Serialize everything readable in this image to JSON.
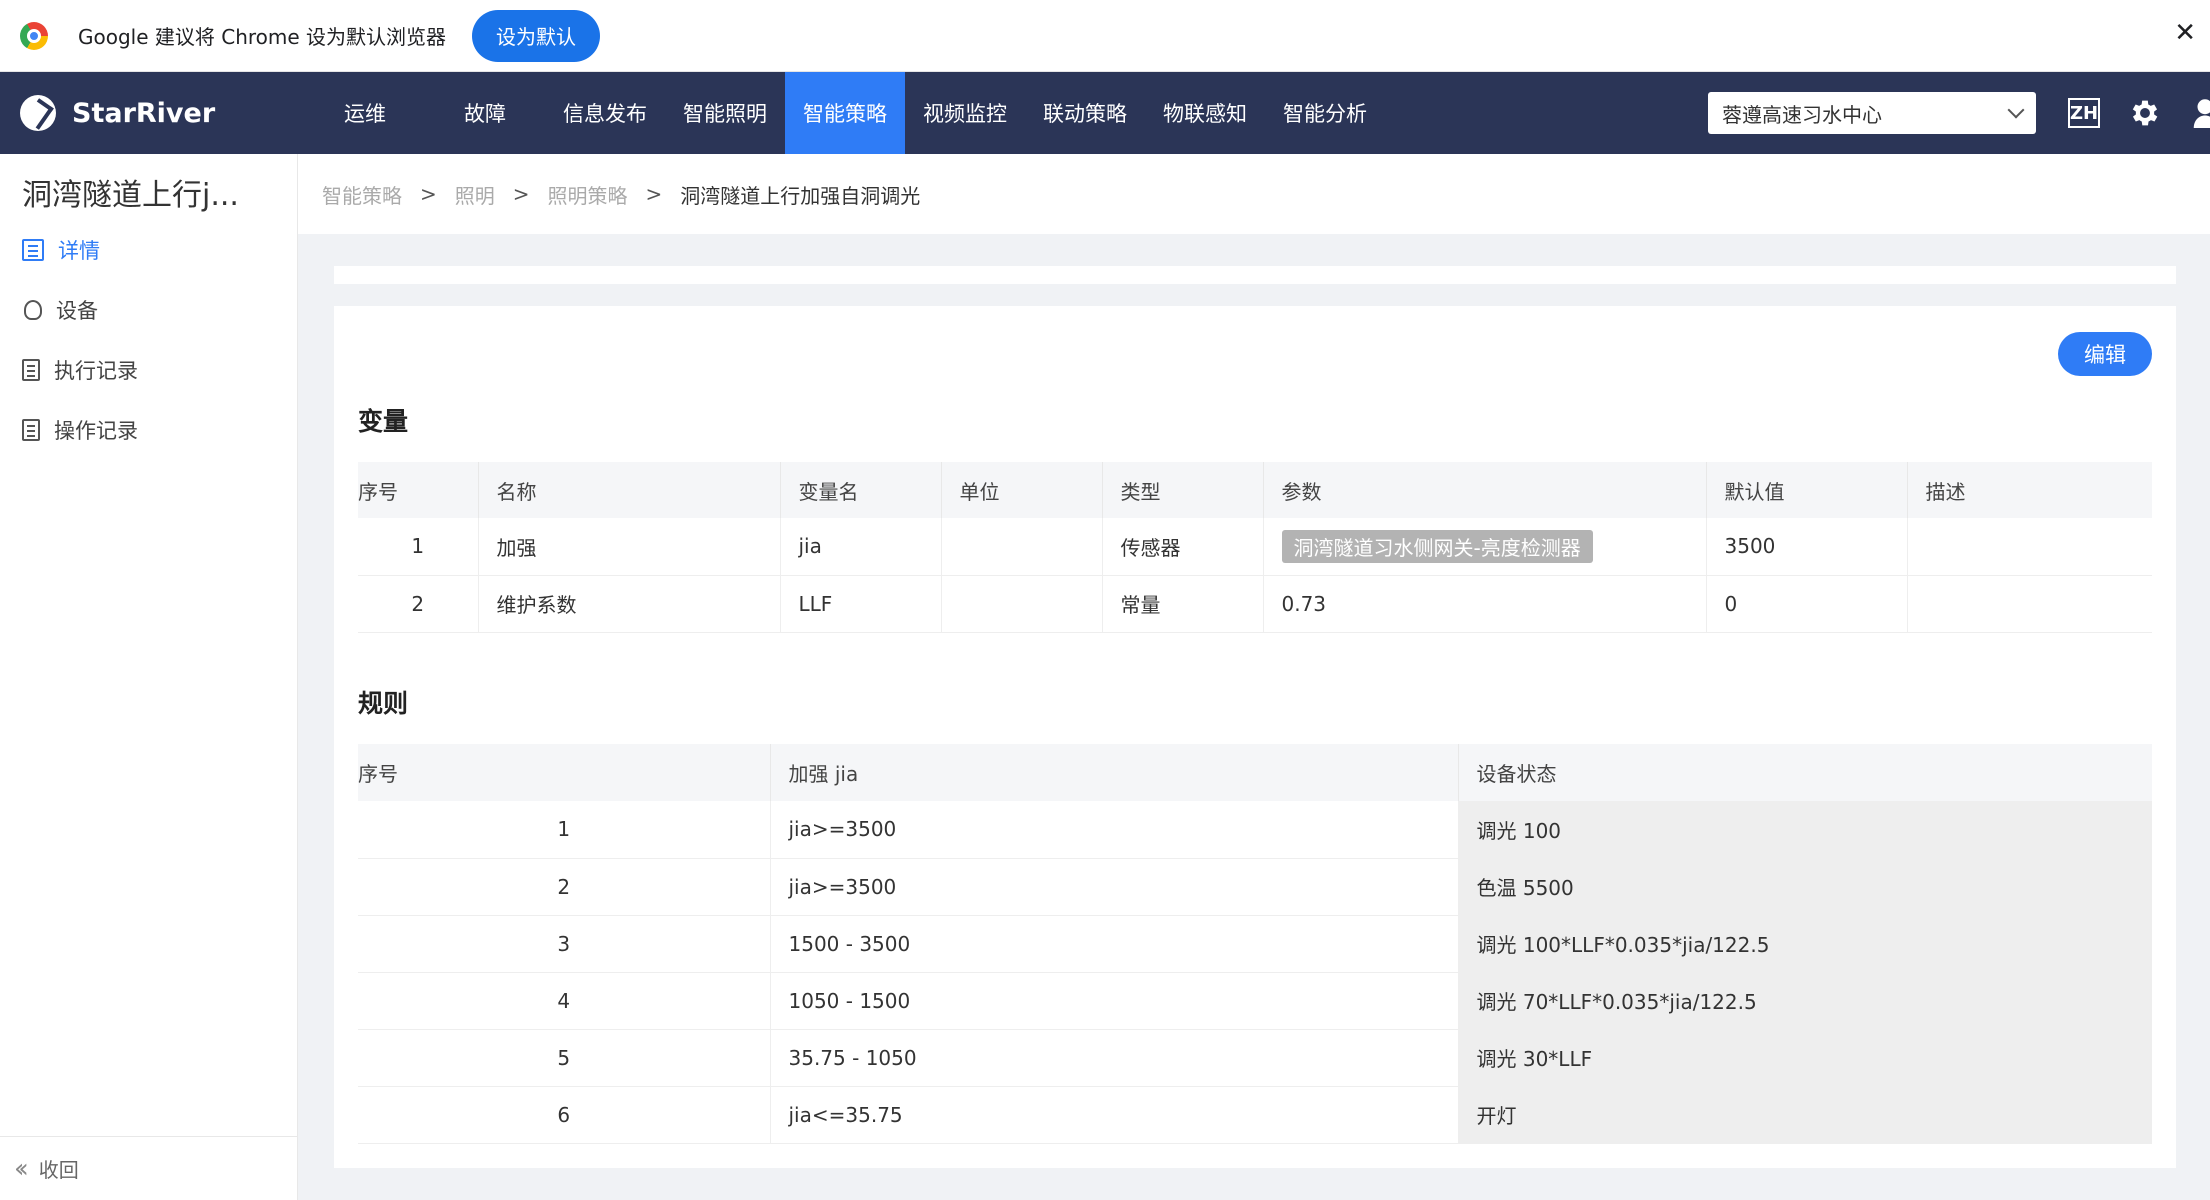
{
  "infobar": {
    "message": "Google 建议将 Chrome 设为默认浏览器",
    "button": "设为默认",
    "close": "✕"
  },
  "nav": {
    "brand": "StarRiver",
    "items": [
      {
        "label": "运维"
      },
      {
        "label": "故障"
      },
      {
        "label": "信息发布"
      },
      {
        "label": "智能照明"
      },
      {
        "label": "智能策略",
        "active": true
      },
      {
        "label": "视频监控"
      },
      {
        "label": "联动策略"
      },
      {
        "label": "物联感知"
      },
      {
        "label": "智能分析"
      }
    ],
    "org": "蓉遵高速习水中心",
    "lang": "ZH"
  },
  "sidebar": {
    "title": "洞湾隧道上行j...",
    "items": [
      {
        "label": "详情",
        "icon": "list-icon",
        "active": true
      },
      {
        "label": "设备",
        "icon": "bulb-icon"
      },
      {
        "label": "执行记录",
        "icon": "record-icon"
      },
      {
        "label": "操作记录",
        "icon": "log-icon"
      }
    ],
    "collapse": "收回"
  },
  "breadcrumb": {
    "items": [
      "智能策略",
      "照明",
      "照明策略"
    ],
    "current": "洞湾隧道上行加强自洞调光"
  },
  "main": {
    "edit_button": "编辑",
    "variables": {
      "title": "变量",
      "headers": [
        "序号",
        "名称",
        "变量名",
        "单位",
        "类型",
        "参数",
        "默认值",
        "描述"
      ],
      "rows": [
        {
          "no": "1",
          "name": "加强",
          "var": "jia",
          "unit": "",
          "type": "传感器",
          "param": "洞湾隧道习水侧网关-亮度检测器",
          "param_tag": true,
          "default": "3500",
          "desc": ""
        },
        {
          "no": "2",
          "name": "维护系数",
          "var": "LLF",
          "unit": "",
          "type": "常量",
          "param": "0.73",
          "param_tag": false,
          "default": "0",
          "desc": ""
        }
      ]
    },
    "rules": {
      "title": "规则",
      "headers": [
        "序号",
        "加强 jia",
        "设备状态"
      ],
      "rows": [
        {
          "no": "1",
          "cond": "jia>=3500",
          "state": "调光 100"
        },
        {
          "no": "2",
          "cond": "jia>=3500",
          "state": "色温 5500"
        },
        {
          "no": "3",
          "cond": "1500 - 3500",
          "state": "调光 100*LLF*0.035*jia/122.5"
        },
        {
          "no": "4",
          "cond": "1050 - 1500",
          "state": "调光 70*LLF*0.035*jia/122.5"
        },
        {
          "no": "5",
          "cond": "35.75 - 1050",
          "state": "调光 30*LLF"
        },
        {
          "no": "6",
          "cond": "jia<=35.75",
          "state": "开灯"
        }
      ]
    }
  },
  "colors": {
    "nav_bg": "#2b3557",
    "accent": "#2f7cf6"
  }
}
